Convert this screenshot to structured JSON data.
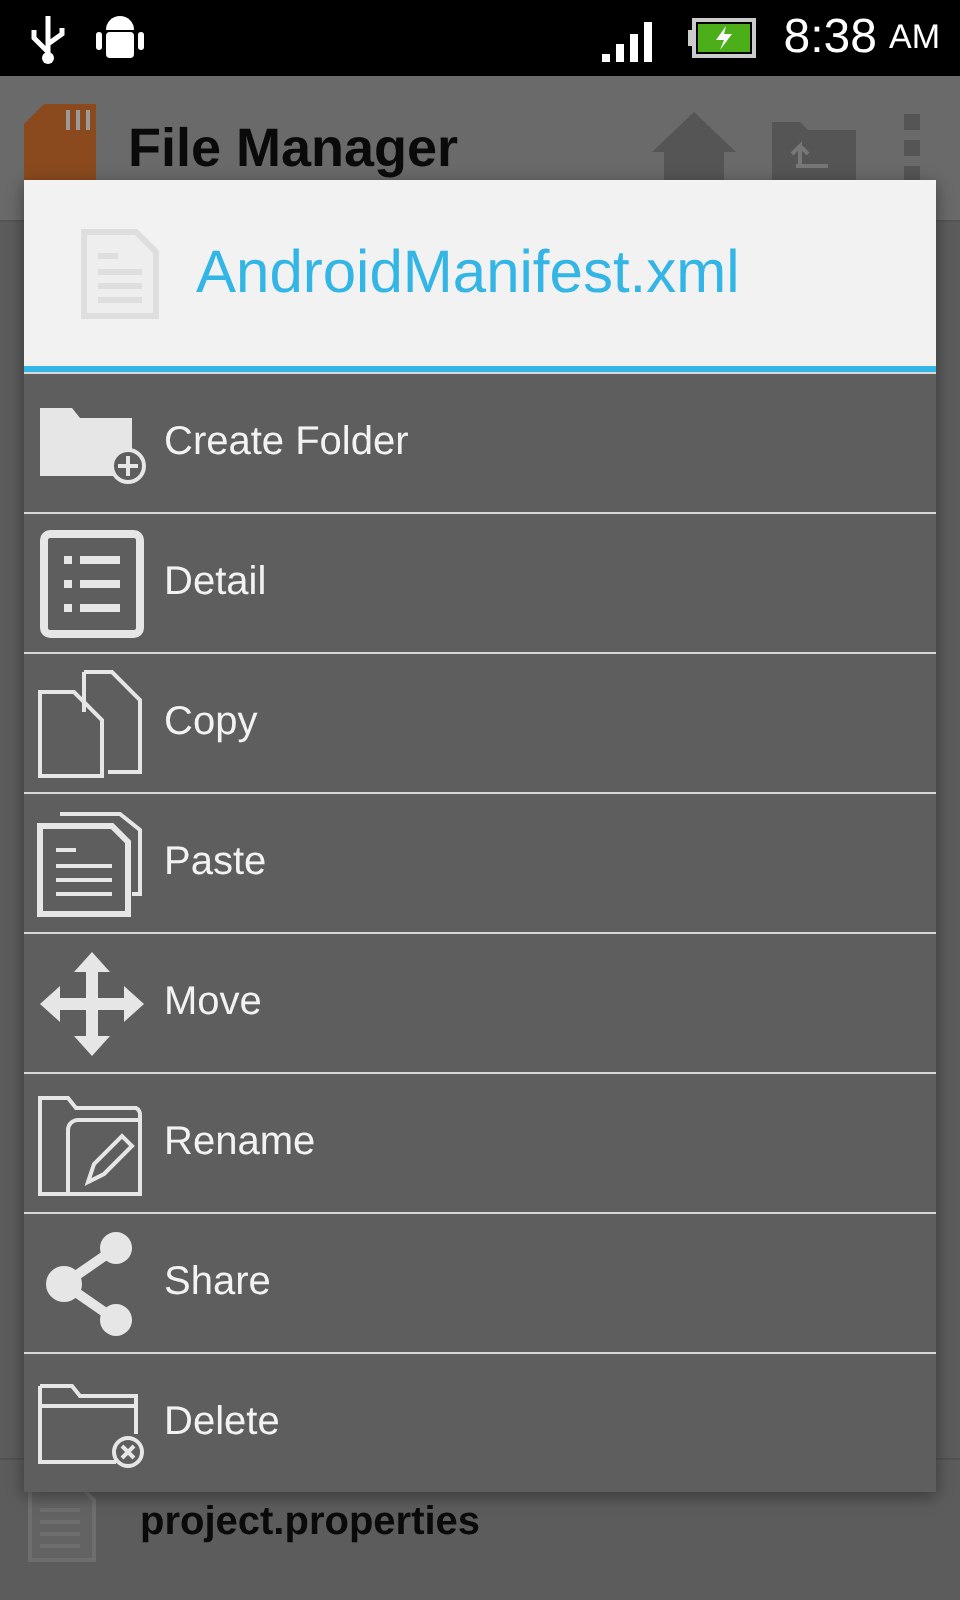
{
  "status_bar": {
    "time": "8:38",
    "meridiem": "AM"
  },
  "app_bar": {
    "title": "File Manager"
  },
  "file_list": [
    {
      "name": "project.properties"
    }
  ],
  "dialog": {
    "title": "AndroidManifest.xml",
    "items": [
      {
        "label": "Create Folder"
      },
      {
        "label": "Detail"
      },
      {
        "label": "Copy"
      },
      {
        "label": "Paste"
      },
      {
        "label": "Move"
      },
      {
        "label": "Rename"
      },
      {
        "label": "Share"
      },
      {
        "label": "Delete"
      }
    ]
  }
}
